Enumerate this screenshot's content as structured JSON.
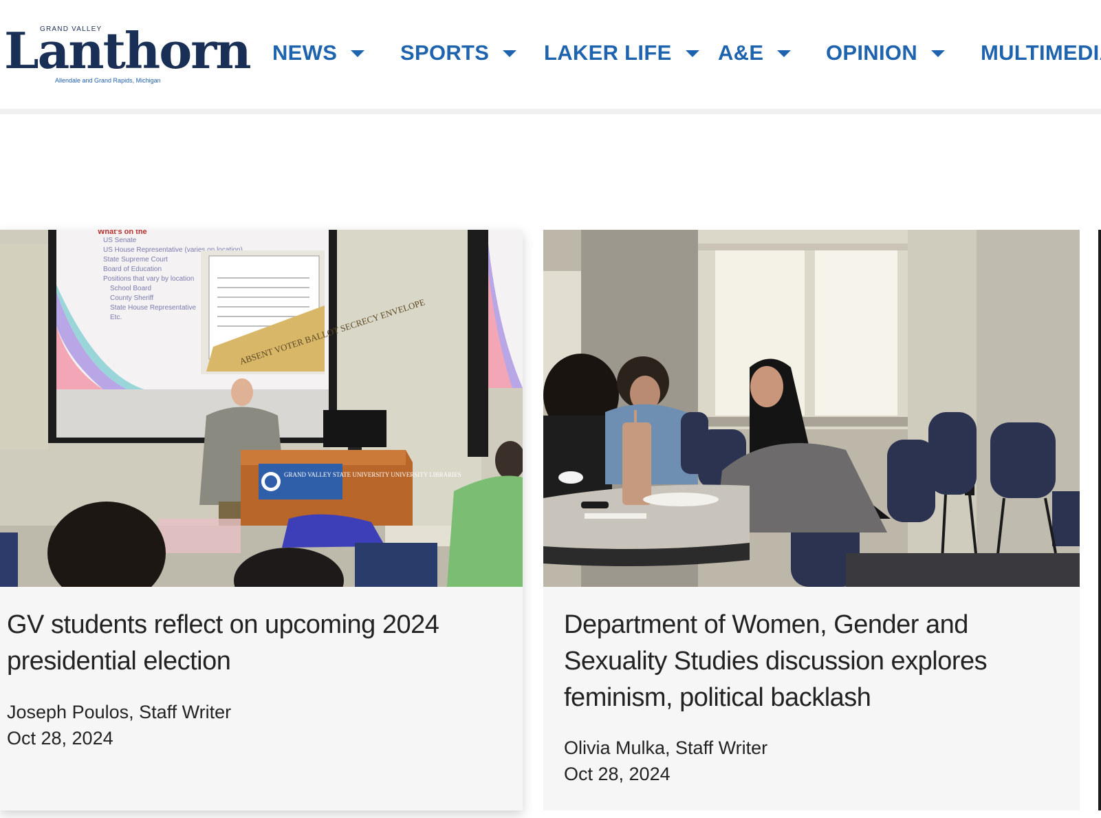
{
  "site": {
    "logo_kicker": "GRAND VALLEY",
    "logo_name": "Lanthorn",
    "logo_tagline": "Allendale and Grand Rapids, Michigan"
  },
  "nav": {
    "items": [
      {
        "label": "NEWS"
      },
      {
        "label": "SPORTS"
      },
      {
        "label": "LAKER LIFE"
      },
      {
        "label": "A&E"
      },
      {
        "label": "OPINION"
      },
      {
        "label": "MULTIMEDIA"
      }
    ]
  },
  "articles": [
    {
      "title": "GV students reflect on upcoming 2024 presidential election",
      "author": "Joseph Poulos, Staff Writer",
      "date": "Oct 28, 2024",
      "image": {
        "slide_heading": "What's on the",
        "slide_bullets": [
          "US Senate",
          "US House Representative (varies on location)",
          "State Supreme Court",
          "Board of Education",
          "Positions that vary by location",
          "School Board",
          "County Sheriff",
          "State House Representative",
          "Etc."
        ],
        "envelope_text": "ABSENT VOTER BALLOT SECRECY ENVELOPE",
        "podium_sign": "GRAND VALLEY STATE UNIVERSITY UNIVERSITY LIBRARIES"
      }
    },
    {
      "title": "Department of Women, Gender and Sexuality Studies discussion explores feminism, political backlash",
      "author": "Olivia Mulka, Staff Writer",
      "date": "Oct 28, 2024"
    }
  ],
  "colors": {
    "nav": "#1e63ad",
    "logo": "#1a2f55",
    "card_bg": "#f6f6f6",
    "text": "#222222"
  }
}
